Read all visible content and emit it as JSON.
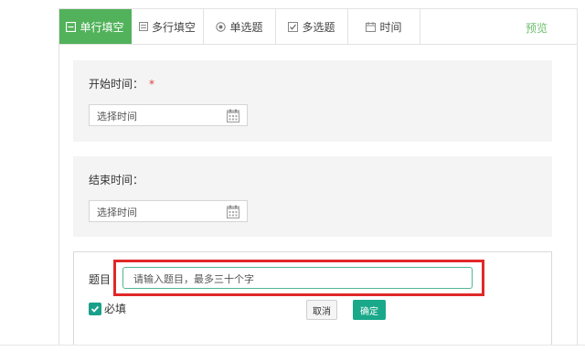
{
  "tabs": [
    {
      "label": "单行填空",
      "icon": "single-line-icon",
      "active": true
    },
    {
      "label": "多行填空",
      "icon": "multi-line-icon",
      "active": false
    },
    {
      "label": "单选题",
      "icon": "radio-icon",
      "active": false
    },
    {
      "label": "多选题",
      "icon": "checkbox-icon",
      "active": false
    },
    {
      "label": "时间",
      "icon": "calendar-icon",
      "active": false
    }
  ],
  "preview_label": "预览",
  "start_time": {
    "label": "开始时间：",
    "required_mark": "*",
    "placeholder": "选择时间",
    "icon": "calendar-icon"
  },
  "end_time": {
    "label": "结束时间：",
    "placeholder": "选择时间",
    "icon": "calendar-icon"
  },
  "editor": {
    "title_label": "题目",
    "title_placeholder": "请输入题目，最多三十个字",
    "required_label": "必填",
    "required_checked": true,
    "cancel_label": "取消",
    "confirm_label": "确定"
  },
  "colors": {
    "accent": "#52b25b",
    "confirm": "#19a88a",
    "highlight": "#e02828",
    "preview": "#6fbf70"
  }
}
